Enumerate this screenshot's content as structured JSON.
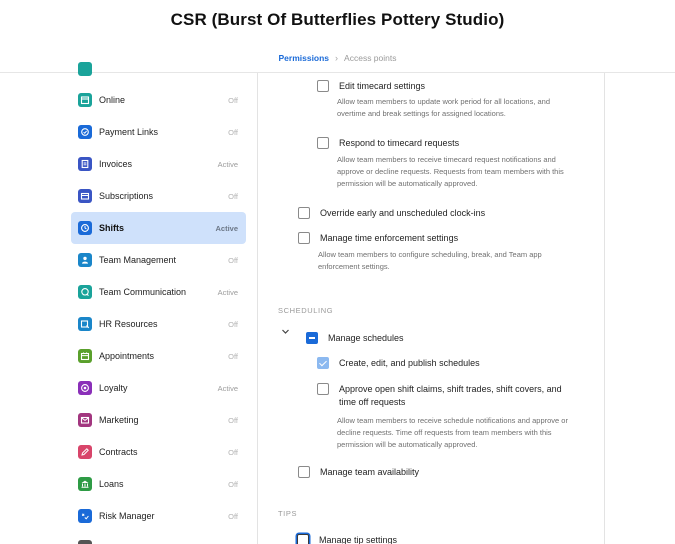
{
  "header": {
    "title": "CSR (Burst Of Butterflies Pottery Studio)",
    "breadcrumb": {
      "current": "Permissions",
      "separator": "›",
      "next": "Access points"
    }
  },
  "sidebar": {
    "items": [
      {
        "label": "Online",
        "status": "Off",
        "icon": "online-store-icon",
        "color": "#1aa39a"
      },
      {
        "label": "Payment Links",
        "status": "Off",
        "icon": "payment-link-icon",
        "color": "#1a6ad8"
      },
      {
        "label": "Invoices",
        "status": "Active",
        "icon": "invoice-icon",
        "color": "#3a55c4"
      },
      {
        "label": "Subscriptions",
        "status": "Off",
        "icon": "subscription-icon",
        "color": "#3a55c4"
      },
      {
        "label": "Shifts",
        "status": "Active",
        "icon": "clock-icon",
        "color": "#1a6ad8"
      },
      {
        "label": "Team Management",
        "status": "Off",
        "icon": "person-icon",
        "color": "#1a86c9"
      },
      {
        "label": "Team Communication",
        "status": "Active",
        "icon": "chat-icon",
        "color": "#1aa39a"
      },
      {
        "label": "HR Resources",
        "status": "Off",
        "icon": "hr-icon",
        "color": "#1a86c9"
      },
      {
        "label": "Appointments",
        "status": "Off",
        "icon": "calendar-icon",
        "color": "#5aa02c"
      },
      {
        "label": "Loyalty",
        "status": "Active",
        "icon": "loyalty-icon",
        "color": "#8a2fb8"
      },
      {
        "label": "Marketing",
        "status": "Off",
        "icon": "mail-icon",
        "color": "#a2367f"
      },
      {
        "label": "Contracts",
        "status": "Off",
        "icon": "pen-icon",
        "color": "#d8456a"
      },
      {
        "label": "Loans",
        "status": "Off",
        "icon": "bank-icon",
        "color": "#2e9b45"
      },
      {
        "label": "Risk Manager",
        "status": "Off",
        "icon": "shield-x-icon",
        "color": "#1a6ad8"
      }
    ]
  },
  "permissions": {
    "edit_timecard": {
      "label": "Edit timecard settings",
      "desc": "Allow team members to update work period for all locations, and overtime and break settings for assigned locations."
    },
    "respond_timecard": {
      "label": "Respond to timecard requests",
      "desc": "Allow team members to receive timecard request notifications and approve or decline requests. Requests from team members with this permission will be automatically approved."
    },
    "override_clockins": {
      "label": "Override early and unscheduled clock-ins"
    },
    "time_enforcement": {
      "label": "Manage time enforcement settings",
      "desc": "Allow team members to configure scheduling, break, and Team app enforcement settings."
    },
    "scheduling_section": "SCHEDULING",
    "manage_schedules": {
      "label": "Manage schedules"
    },
    "publish_schedules": {
      "label": "Create, edit, and publish schedules"
    },
    "open_shift": {
      "label": "Approve open shift claims, shift trades, shift covers, and time off requests",
      "desc": "Allow team members to receive schedule notifications and approve or decline requests. Time off requests from team members with this permission will be automatically approved."
    },
    "team_availability": {
      "label": "Manage team availability"
    },
    "tips_section": "TIPS",
    "tip_settings": {
      "label": "Manage tip settings"
    }
  }
}
